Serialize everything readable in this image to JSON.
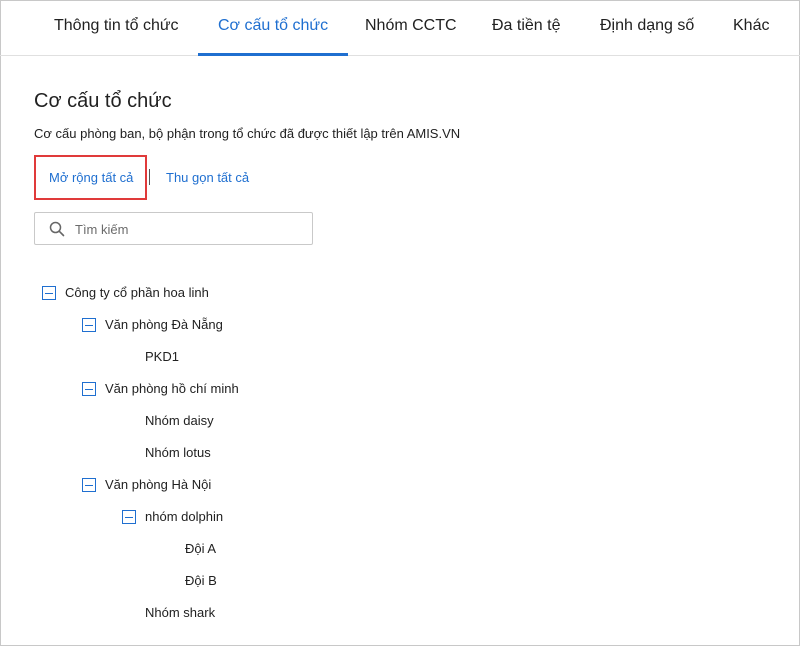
{
  "tabs": [
    {
      "label": "Thông tin tổ chức",
      "active": false
    },
    {
      "label": "Cơ cấu tổ chức",
      "active": true
    },
    {
      "label": "Nhóm CCTC",
      "active": false
    },
    {
      "label": "Đa tiền tệ",
      "active": false
    },
    {
      "label": "Định dạng số",
      "active": false
    },
    {
      "label": "Khác",
      "active": false
    }
  ],
  "page": {
    "title": "Cơ cấu tổ chức",
    "description": "Cơ cấu phòng ban, bộ phận trong tổ chức đã được thiết lập trên AMIS.VN"
  },
  "actions": {
    "expand_all": "Mở rộng tất cả",
    "collapse_all": "Thu gọn tất cả"
  },
  "search": {
    "placeholder": "Tìm kiếm",
    "value": ""
  },
  "tree": {
    "root": "Công ty cổ phần hoa linh",
    "da_nang": "Văn phòng Đà Nẵng",
    "pkd1": "PKD1",
    "hcm": "Văn phòng hồ chí minh",
    "daisy": "Nhóm daisy",
    "lotus": "Nhóm lotus",
    "ha_noi": "Văn phòng Hà Nội",
    "dolphin": "nhóm dolphin",
    "doi_a": "Đội A",
    "doi_b": "Đội B",
    "shark": "Nhóm shark"
  },
  "colors": {
    "accent": "#1f6fd0",
    "highlight": "#e03a3a"
  }
}
